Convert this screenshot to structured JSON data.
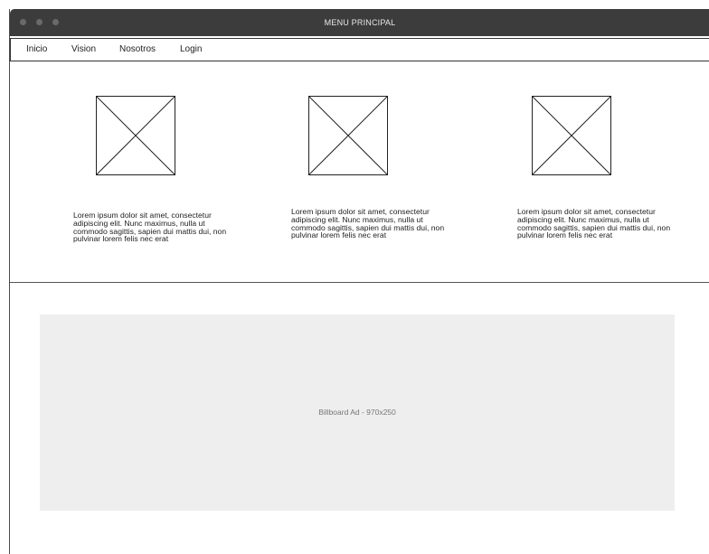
{
  "window": {
    "title": "MENU PRINCIPAL"
  },
  "nav": {
    "items": [
      {
        "label": "Inicio"
      },
      {
        "label": "Vision"
      },
      {
        "label": "Nosotros"
      },
      {
        "label": "Login"
      }
    ]
  },
  "features": [
    {
      "image_icon": "image-placeholder-icon",
      "text": "Lorem ipsum dolor sit amet, consectetur adipiscing elit. Nunc maximus, nulla ut commodo sagittis, sapien dui mattis dui, non pulvinar lorem felis nec erat"
    },
    {
      "image_icon": "image-placeholder-icon",
      "text": "Lorem ipsum dolor sit amet, consectetur adipiscing elit. Nunc maximus, nulla ut commodo sagittis, sapien dui mattis dui, non pulvinar lorem felis nec erat"
    },
    {
      "image_icon": "image-placeholder-icon",
      "text": "Lorem ipsum dolor sit amet, consectetur adipiscing elit. Nunc maximus, nulla ut commodo sagittis, sapien dui mattis dui, non pulvinar lorem felis nec erat"
    }
  ],
  "billboard": {
    "label": "Billboard Ad - 970x250"
  },
  "colors": {
    "titlebar": "#3c3c3c",
    "billboard_bg": "#eeeeee"
  }
}
